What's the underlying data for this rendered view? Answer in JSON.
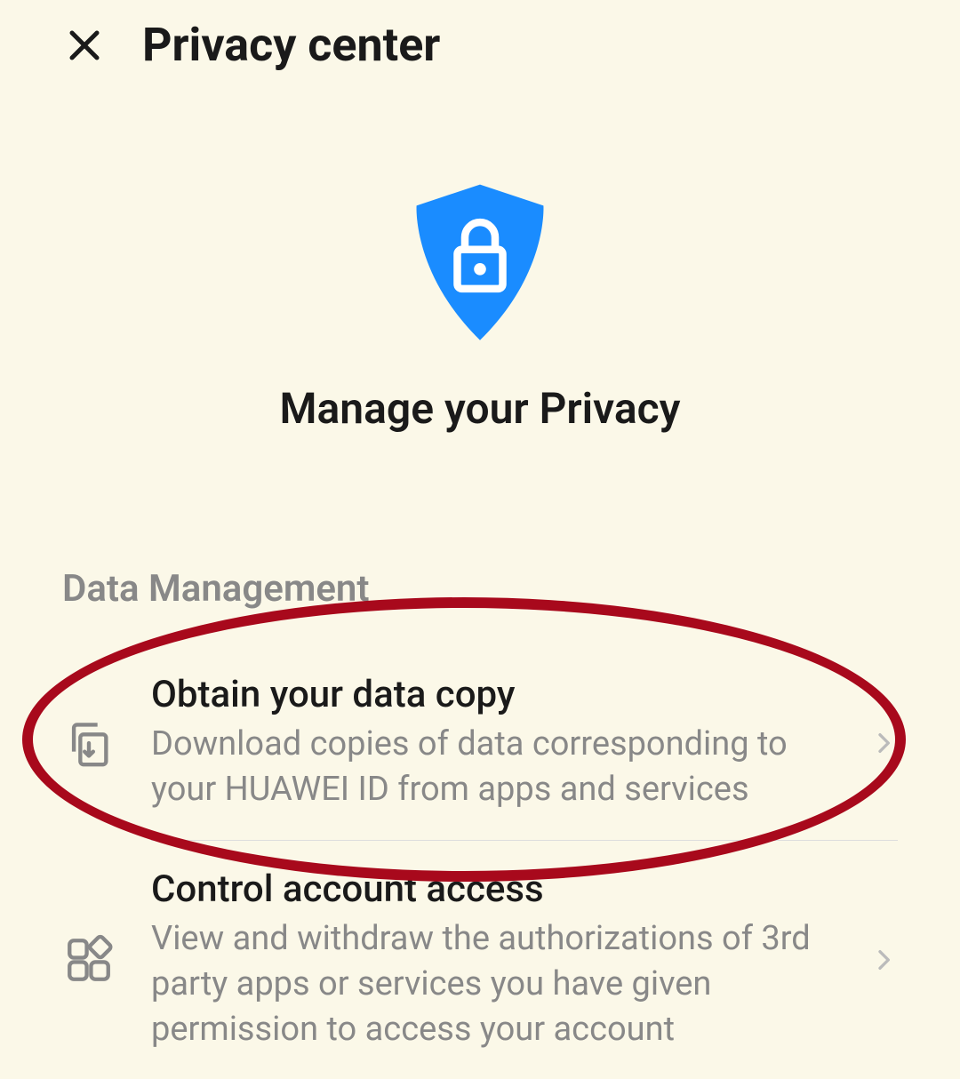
{
  "header": {
    "title": "Privacy center"
  },
  "hero": {
    "title": "Manage your Privacy"
  },
  "section": {
    "header": "Data Management",
    "items": [
      {
        "title": "Obtain your data copy",
        "subtitle": "Download copies of data corresponding to your HUAWEI ID from apps and services"
      },
      {
        "title": "Control account access",
        "subtitle": "View and withdraw the authorizations of 3rd party apps or services you have given permission to access your account"
      }
    ]
  },
  "colors": {
    "accent": "#1e90ff",
    "annotation": "#a8091c"
  }
}
